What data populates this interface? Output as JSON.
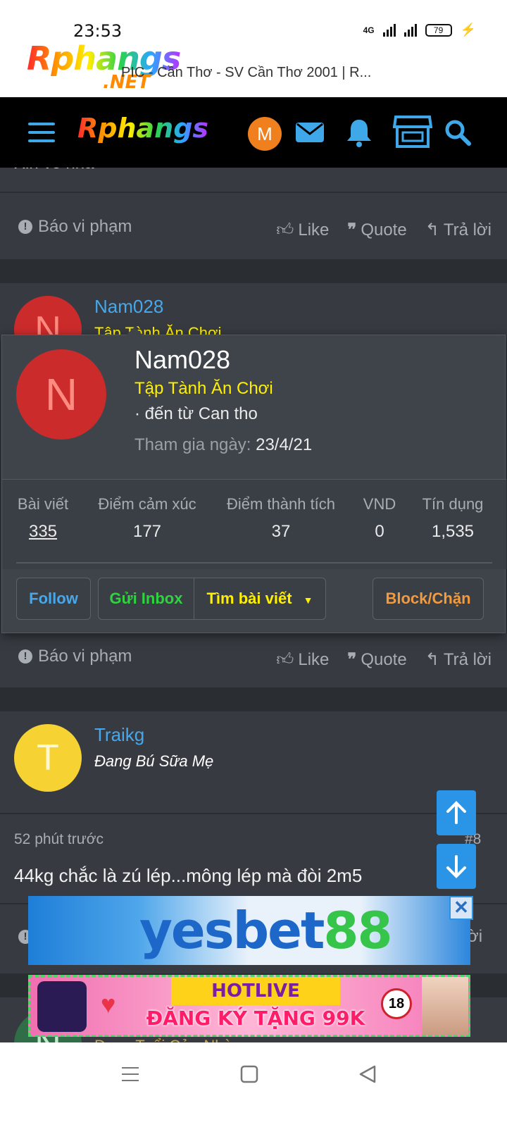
{
  "status_bar": {
    "time": "23:53",
    "network": "4G",
    "battery": "79"
  },
  "browser": {
    "logo_main": "Rphangs",
    "logo_net": ".NET",
    "tab_title": "PIC - Cần Thơ - SV Cần Thơ 2001 | R..."
  },
  "navbar": {
    "logo": "Rphangs",
    "avatar_letter": "M",
    "accent": "#3ea8e8"
  },
  "top_post": {
    "partial_text": "Xin về nha",
    "report_label": "Báo vi phạm",
    "like_label": "Like",
    "quote_label": "Quote",
    "reply_label": "Trả lời"
  },
  "post_nam028": {
    "username": "Nam028",
    "user_title": "Tập Tành Ăn Chơi",
    "avatar_letter": "N"
  },
  "popup": {
    "username": "Nam028",
    "user_title": "Tập Tành Ăn Chơi",
    "from": "· đến từ Can tho",
    "joined_label": "Tham gia ngày:",
    "joined_date": "23/4/21",
    "avatar_letter": "N",
    "stats": [
      {
        "label": "Bài viết",
        "value": "335"
      },
      {
        "label": "Điểm cảm xúc",
        "value": "177"
      },
      {
        "label": "Điểm thành tích",
        "value": "37"
      },
      {
        "label": "VND",
        "value": "0"
      },
      {
        "label": "Tín dụng",
        "value": "1,535"
      }
    ],
    "buttons": {
      "follow": "Follow",
      "inbox": "Gửi Inbox",
      "find_posts": "Tìm bài viết",
      "block": "Block/Chặn"
    }
  },
  "second_actions": {
    "report_label": "Báo vi phạm",
    "like_label": "Like",
    "quote_label": "Quote",
    "reply_label": "Trả lời"
  },
  "post_traikg": {
    "username": "Traikg",
    "user_title": "Đang Bú Sữa Mẹ",
    "avatar_letter": "T",
    "time": "52 phút trước",
    "post_number": "#8",
    "body": "44kg chắc là zú lép...mông lép mà đòi 2m5",
    "reply_partial": "ời"
  },
  "next_post": {
    "avatar_letter": "N",
    "user_title_partial": "Dang Tuổi Cửa Nhà"
  },
  "ads": {
    "ad1_text_a": "yesbet",
    "ad1_text_b": "88",
    "ad1_close": "✕",
    "ad2_top": "HOTLIVE",
    "ad2_bottom": "ĐĂNG KÝ TẶNG 99K",
    "ad2_badge": "18"
  }
}
